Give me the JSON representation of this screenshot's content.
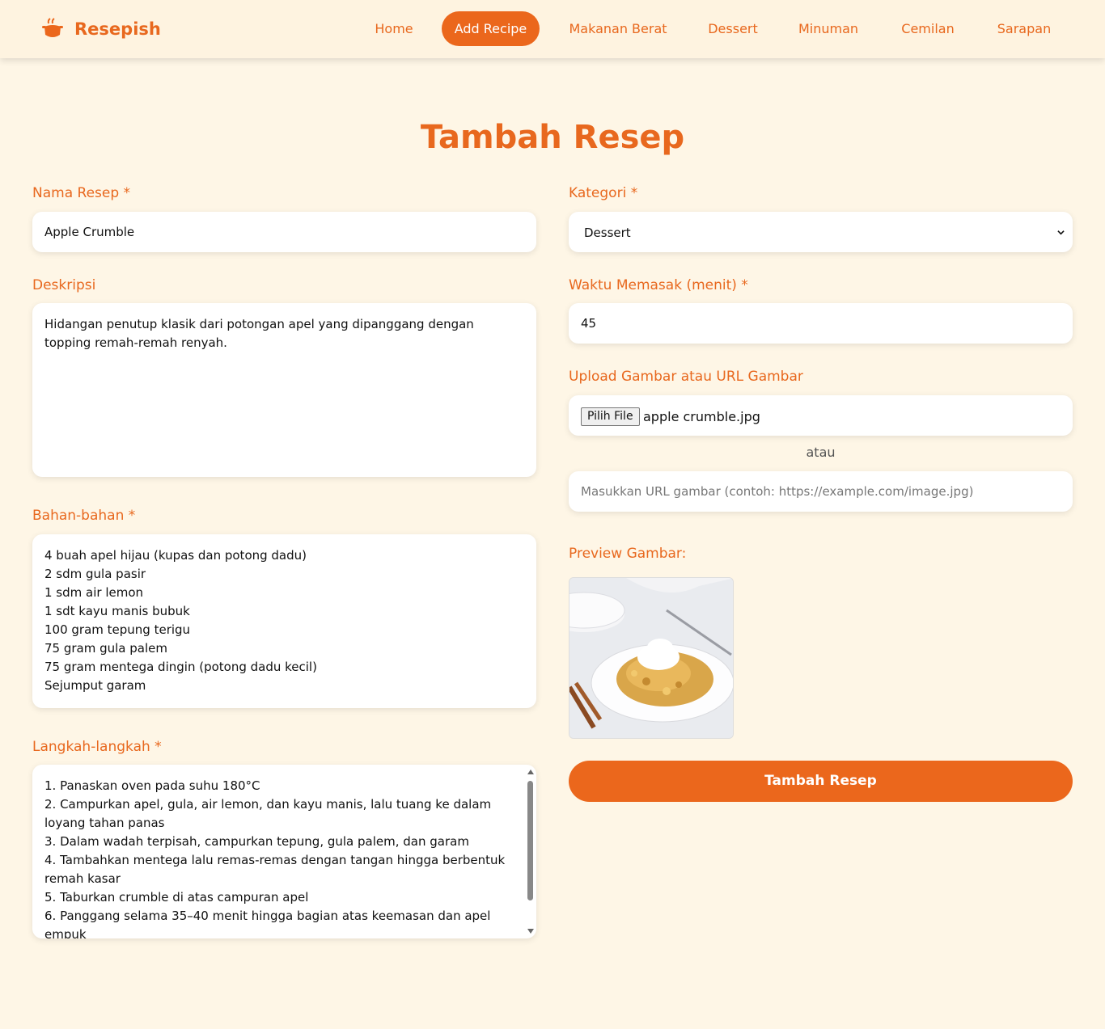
{
  "brand": {
    "name": "Resepish",
    "icon": "cooking-pot-icon"
  },
  "nav": {
    "items": [
      {
        "label": "Home",
        "active": false
      },
      {
        "label": "Add Recipe",
        "active": true
      },
      {
        "label": "Makanan Berat",
        "active": false
      },
      {
        "label": "Dessert",
        "active": false
      },
      {
        "label": "Minuman",
        "active": false
      },
      {
        "label": "Cemilan",
        "active": false
      },
      {
        "label": "Sarapan",
        "active": false
      }
    ]
  },
  "page_title": "Tambah Resep",
  "form": {
    "nama_resep": {
      "label": "Nama Resep *",
      "value": "Apple Crumble"
    },
    "kategori": {
      "label": "Kategori *",
      "value": "Dessert"
    },
    "deskripsi": {
      "label": "Deskripsi",
      "value": "Hidangan penutup klasik dari potongan apel yang dipanggang dengan topping remah-remah renyah."
    },
    "waktu": {
      "label": "Waktu Memasak (menit) *",
      "value": "45"
    },
    "upload": {
      "label": "Upload Gambar atau URL Gambar",
      "button_label": "Pilih File",
      "file_name": "apple crumble.jpg",
      "separator": "atau",
      "url_placeholder": "Masukkan URL gambar (contoh: https://example.com/image.jpg)"
    },
    "bahan": {
      "label": "Bahan-bahan *",
      "value": "4 buah apel hijau (kupas dan potong dadu)\n2 sdm gula pasir\n1 sdm air lemon\n1 sdt kayu manis bubuk\n100 gram tepung terigu\n75 gram gula palem\n75 gram mentega dingin (potong dadu kecil)\nSejumput garam"
    },
    "preview": {
      "label": "Preview Gambar:"
    },
    "langkah": {
      "label": "Langkah-langkah *",
      "value": "1. Panaskan oven pada suhu 180°C\n2. Campurkan apel, gula, air lemon, dan kayu manis, lalu tuang ke dalam loyang tahan panas\n3. Dalam wadah terpisah, campurkan tepung, gula palem, dan garam\n4. Tambahkan mentega lalu remas-remas dengan tangan hingga berbentuk remah kasar\n5. Taburkan crumble di atas campuran apel\n6. Panggang selama 35–40 menit hingga bagian atas keemasan dan apel empuk"
    },
    "submit_label": "Tambah Resep"
  },
  "colors": {
    "accent": "#eb671c",
    "background": "#fef6e6",
    "navbar": "#fef3e0"
  }
}
